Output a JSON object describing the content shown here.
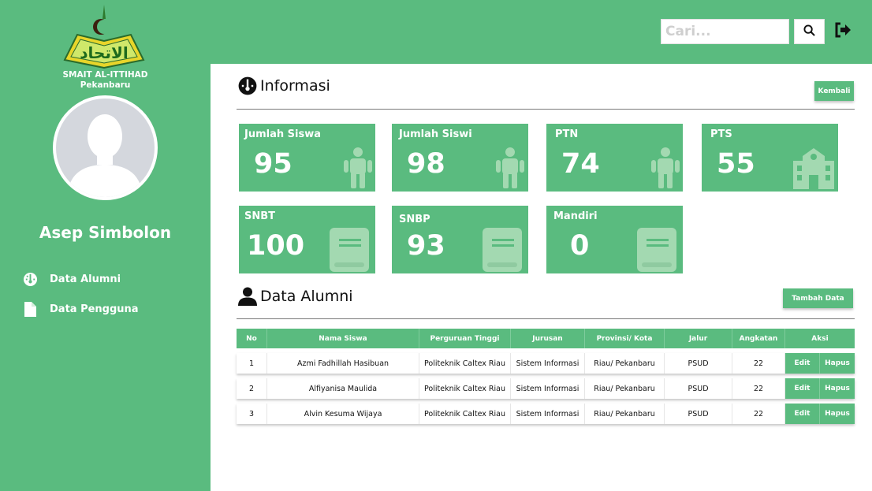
{
  "sidebar": {
    "logo_text": "الاتحاد",
    "school_name": "SMAIT AL-ITTIHAD",
    "school_city": "Pekanbaru",
    "user_name": "Asep Simbolon",
    "nav": [
      {
        "label": "Data Alumni",
        "icon": "dashboard-icon"
      },
      {
        "label": "Data Pengguna",
        "icon": "file-icon"
      }
    ]
  },
  "topbar": {
    "search_placeholder": "Cari...",
    "search_icon": "search-icon",
    "logout_icon": "logout-icon"
  },
  "informasi": {
    "title": "Informasi",
    "back_button": "Kembali",
    "cards": [
      {
        "label": "Jumlah Siswa",
        "value": "95",
        "icon": "person-icon"
      },
      {
        "label": "Jumlah Siswi",
        "value": "98",
        "icon": "person-icon"
      },
      {
        "label": "PTN",
        "value": "74",
        "icon": "person-icon"
      },
      {
        "label": "PTS",
        "value": "55",
        "icon": "school-icon"
      },
      {
        "label": "SNBT",
        "value": "100",
        "icon": "book-icon"
      },
      {
        "label": "SNBP",
        "value": "93",
        "icon": "book-icon"
      },
      {
        "label": "Mandiri",
        "value": "0",
        "icon": "book-icon"
      }
    ]
  },
  "alumni": {
    "title": "Data Alumni",
    "add_button": "Tambah Data",
    "columns": [
      "No",
      "Nama Siswa",
      "Perguruan Tinggi",
      "Jurusan",
      "Provinsi/ Kota",
      "Jalur",
      "Angkatan",
      "Aksi"
    ],
    "rows": [
      {
        "no": "1",
        "nama": "Azmi Fadhillah Hasibuan",
        "pt": "Politeknik Caltex Riau",
        "jurusan": "Sistem Informasi",
        "provinsi": "Riau/ Pekanbaru",
        "jalur": "PSUD",
        "angkatan": "22"
      },
      {
        "no": "2",
        "nama": "Alfiyanisa Maulida",
        "pt": "Politeknik Caltex Riau",
        "jurusan": "Sistem Informasi",
        "provinsi": "Riau/ Pekanbaru",
        "jalur": "PSUD",
        "angkatan": "22"
      },
      {
        "no": "3",
        "nama": "Alvin Kesuma Wijaya",
        "pt": "Politeknik Caltex Riau",
        "jurusan": "Sistem Informasi",
        "provinsi": "Riau/ Pekanbaru",
        "jalur": "PSUD",
        "angkatan": "22"
      }
    ],
    "edit_label": "Edit",
    "delete_label": "Hapus"
  },
  "colors": {
    "primary_green": "#5abb7f",
    "icon_green": "#a3d9b1"
  }
}
